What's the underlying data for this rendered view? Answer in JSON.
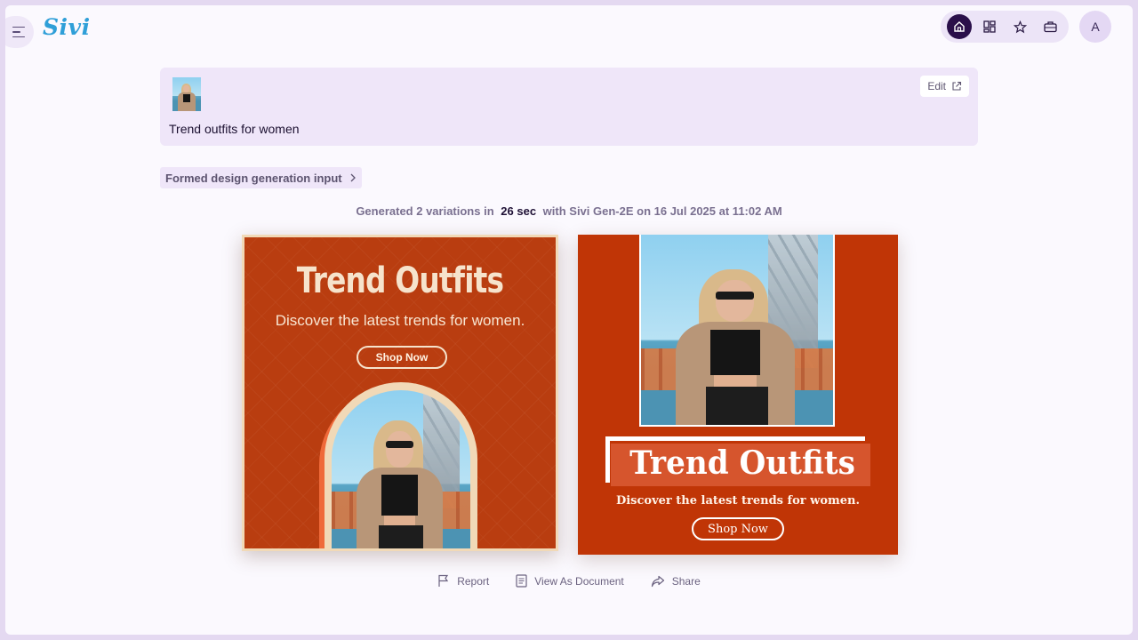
{
  "app": {
    "logo": "Sivi",
    "user_initial": "A"
  },
  "topnav": {
    "items": [
      "home-icon",
      "dashboard-icon",
      "star-icon",
      "briefcase-icon"
    ],
    "active": "home-icon"
  },
  "prompt": {
    "text": "Trend outfits for women",
    "edit_label": "Edit"
  },
  "formed_input": {
    "label": "Formed design generation input"
  },
  "generation": {
    "prefix": "Generated 2 variations in",
    "duration": "26 sec",
    "suffix": "with Sivi Gen-2E on 16 Jul 2025 at 11:02 AM"
  },
  "designs": [
    {
      "title": "Trend Outfits",
      "subtitle": "Discover the latest trends for women.",
      "cta": "Shop Now",
      "background": "#b93d10"
    },
    {
      "title": "Trend Outfits",
      "subtitle": "Discover the latest trends for women.",
      "cta": "Shop Now",
      "background": "#c03506"
    }
  ],
  "actions": {
    "report": "Report",
    "view_doc": "View As Document",
    "share": "Share"
  },
  "colors": {
    "accent": "#2a0f4a",
    "logo": "#2f9fd8",
    "card_bg": "#efe6f9"
  }
}
